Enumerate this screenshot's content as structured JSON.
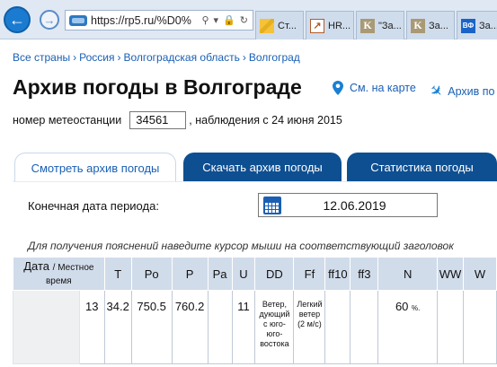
{
  "browser": {
    "url": "https://rp5.ru/%D0%",
    "tabs": [
      {
        "label": "Ст...",
        "icon": "sticky-note-icon"
      },
      {
        "label": "HR...",
        "icon": "hr-icon"
      },
      {
        "label": "\"За...",
        "icon": "k-icon"
      },
      {
        "label": "За...",
        "icon": "k-icon"
      },
      {
        "label": "За...",
        "icon": "vf-icon",
        "icon_text": "ВФ"
      }
    ]
  },
  "breadcrumb": [
    "Все страны",
    "Россия",
    "Волгоградская область",
    "Волгоград"
  ],
  "page": {
    "title": "Архив погоды в Волгограде",
    "map_link": "См. на карте",
    "airport_link": "Архив по"
  },
  "station": {
    "label": "номер метеостанции",
    "value": "34561",
    "since": ", наблюдения с 24 июня 2015"
  },
  "tabs": {
    "view": "Смотреть архив погоды",
    "download": "Скачать архив погоды",
    "stats": "Статистика погоды"
  },
  "period": {
    "label": "Конечная дата периода:",
    "date": "12.06.2019"
  },
  "hint": "Для получения пояснений наведите курсор мыши на соответствующий заголовок",
  "table": {
    "headers": {
      "date": "Дата",
      "local_time": "/ Местное время",
      "T": "T",
      "Po": "Po",
      "P": "P",
      "Pa": "Pa",
      "U": "U",
      "DD": "DD",
      "Ff": "Ff",
      "ff10": "ff10",
      "ff3": "ff3",
      "N": "N",
      "WW": "WW",
      "W": "W"
    },
    "row": {
      "time": "13",
      "T": "34.2",
      "Po": "750.5",
      "P": "760.2",
      "Pa": "",
      "U": "11",
      "DD": "Ветер, дующий с юго-юго-востока",
      "Ff": "Легкий ветер (2 м/с)",
      "ff10": "",
      "ff3": "",
      "N_value": "60",
      "N_unit": "%.",
      "WW": "",
      "W": ""
    }
  }
}
